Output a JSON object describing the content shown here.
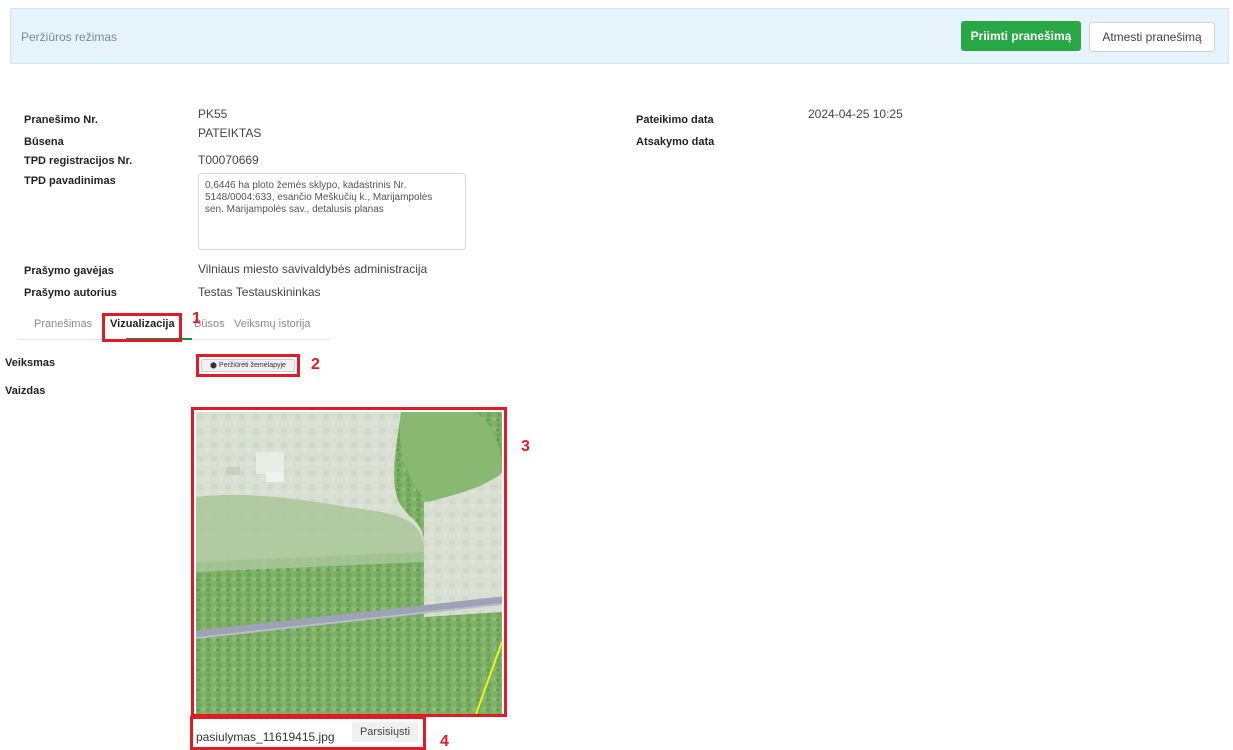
{
  "header": {
    "mode_label": "Peržiūros režimas",
    "accept_label": "Priimti pranešimą",
    "reject_label": "Atmesti pranešimą"
  },
  "details": {
    "report_no_label": "Pranešimo Nr.",
    "report_no_value": "PK55",
    "status_label": "Būsena",
    "status_value": "PATEIKTAS",
    "tpd_reg_label": "TPD registracijos Nr.",
    "tpd_reg_value": "T00070669",
    "tpd_name_label": "TPD pavadinimas",
    "tpd_name_value": "0,6446 ha ploto žemės sklypo, kadastrinis Nr.\n5148/0004:633, esančio Meškučių k., Marijampolės\nsen. Marijampolės sav., detalusis planas",
    "receiver_label": "Prašymo gavėjas",
    "receiver_value": "Vilniaus miesto savivaldybės administracija",
    "author_label": "Prašymo autorius",
    "author_value": "Testas Testauskininkas",
    "submit_date_label": "Pateikimo data",
    "submit_date_value": "2024-04-25 10:25",
    "answer_date_label": "Atsakymo data"
  },
  "tabs": [
    "Pranešimas",
    "Vizualizacija",
    "Būsos",
    "Veiksmų istorija"
  ],
  "visualization": {
    "action_label": "Veiksmas",
    "view_label": "Vaizdas",
    "map_button_label": "Peržiūrėti žemėlapyje",
    "file_name": "pasiulymas_11619415.jpg",
    "download_label": "Parsisiųsti"
  },
  "annotations": [
    "1",
    "2",
    "3",
    "4"
  ],
  "colors": {
    "accent_green": "#28a745",
    "annotation_red": "#e21b26",
    "header_bg": "#e7f3fb"
  }
}
